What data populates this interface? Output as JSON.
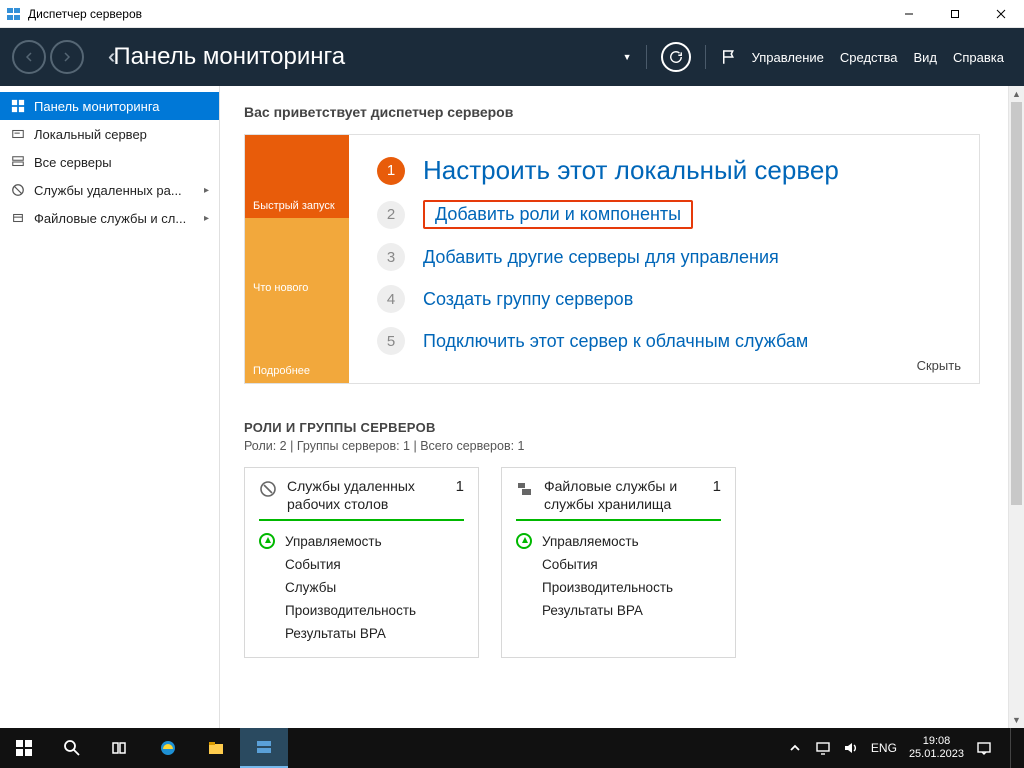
{
  "window": {
    "title": "Диспетчер серверов"
  },
  "header": {
    "page_title": "Панель мониторинга",
    "menus": {
      "manage": "Управление",
      "tools": "Средства",
      "view": "Вид",
      "help": "Справка"
    }
  },
  "sidebar": {
    "items": [
      {
        "label": "Панель мониторинга"
      },
      {
        "label": "Локальный сервер"
      },
      {
        "label": "Все серверы"
      },
      {
        "label": "Службы удаленных ра..."
      },
      {
        "label": "Файловые службы и сл..."
      }
    ]
  },
  "welcome": "Вас приветствует диспетчер серверов",
  "qs_tabs": {
    "quick": "Быстрый запуск",
    "whatsnew": "Что нового",
    "more": "Подробнее"
  },
  "steps": [
    {
      "n": "1",
      "label": "Настроить этот локальный сервер"
    },
    {
      "n": "2",
      "label": "Добавить роли и компоненты"
    },
    {
      "n": "3",
      "label": "Добавить другие серверы для управления"
    },
    {
      "n": "4",
      "label": "Создать группу серверов"
    },
    {
      "n": "5",
      "label": "Подключить этот сервер к облачным службам"
    }
  ],
  "hide": "Скрыть",
  "roles": {
    "title": "РОЛИ И ГРУППЫ СЕРВЕРОВ",
    "subtitle": "Роли: 2 | Группы серверов: 1 | Всего серверов: 1",
    "cards": [
      {
        "title": "Службы удаленных рабочих столов",
        "count": "1",
        "rows": [
          "Управляемость",
          "События",
          "Службы",
          "Производительность",
          "Результаты BPA"
        ]
      },
      {
        "title": "Файловые службы и службы хранилища",
        "count": "1",
        "rows": [
          "Управляемость",
          "События",
          "Производительность",
          "Результаты BPA"
        ]
      }
    ]
  },
  "taskbar": {
    "lang": "ENG",
    "time": "19:08",
    "date": "25.01.2023"
  }
}
